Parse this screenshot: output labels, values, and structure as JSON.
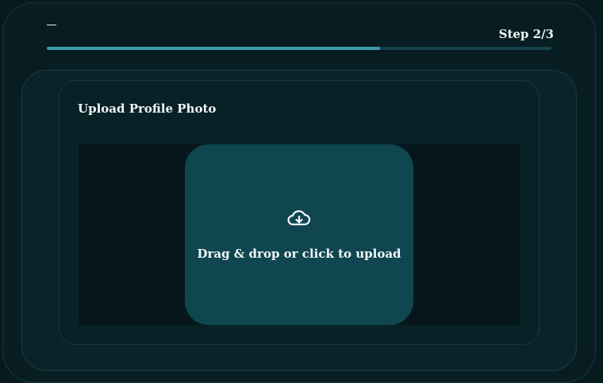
{
  "header": {
    "step_label": "Step 2/3",
    "progress_fraction": 0.66
  },
  "upload": {
    "title": "Upload Profile Photo",
    "dropzone_text": "Drag & drop or click to upload",
    "icon": "cloud-upload-icon"
  },
  "colors": {
    "accent": "#3e9aab",
    "dropzone": "#0f4650",
    "background": "#071a1e"
  }
}
